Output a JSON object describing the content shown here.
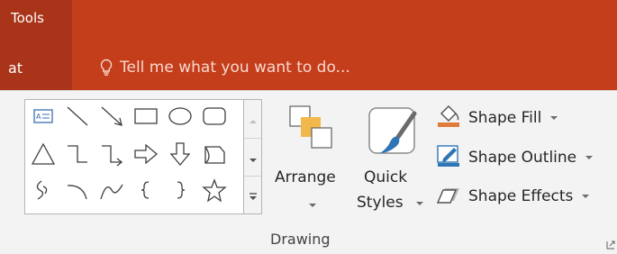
{
  "tab": {
    "contextual_group": "Tools",
    "active_tab_fragment": "at"
  },
  "tell_me": {
    "placeholder": "Tell me what you want to do..."
  },
  "gallery": {
    "shapes": [
      "text-box",
      "line",
      "arrow",
      "rectangle",
      "oval",
      "rounded-rectangle",
      "triangle",
      "elbow-connector",
      "elbow-arrow-connector",
      "right-arrow",
      "down-arrow",
      "flowchart-shape",
      "freeform",
      "arc",
      "curve",
      "left-brace",
      "right-brace",
      "star"
    ]
  },
  "drawing": {
    "arrange_label": "Arrange",
    "quick_styles_line1": "Quick",
    "quick_styles_line2": "Styles",
    "shape_fill": "Shape Fill",
    "shape_outline": "Shape Outline",
    "shape_effects": "Shape Effects",
    "group_label": "Drawing"
  },
  "colors": {
    "ribbon_header": "#c43e1c",
    "active_tab": "#a93419",
    "fill_accent": "#e07b39",
    "outline_accent": "#2e75b6"
  }
}
